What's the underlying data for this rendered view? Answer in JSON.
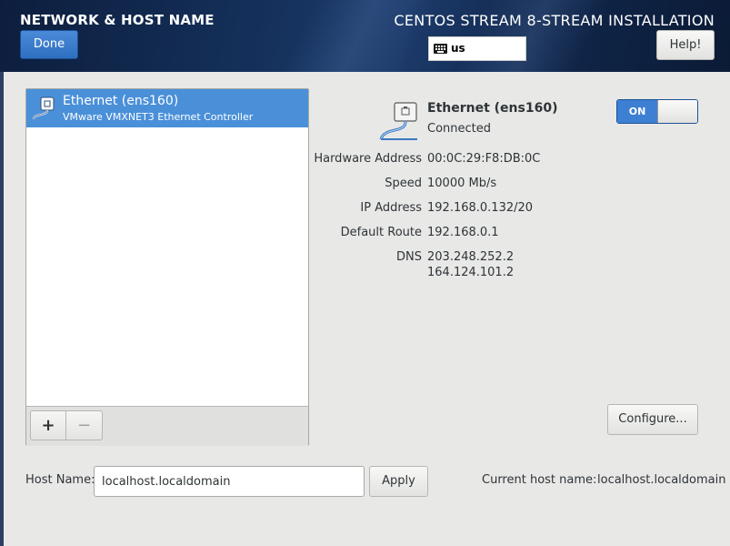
{
  "header": {
    "page_title": "NETWORK & HOST NAME",
    "done_label": "Done",
    "install_title": "CENTOS STREAM 8-STREAM INSTALLATION",
    "keyboard_layout": "us",
    "help_label": "Help!"
  },
  "connections": {
    "items": [
      {
        "name": "Ethernet (ens160)",
        "description": "VMware VMXNET3 Ethernet Controller",
        "selected": true
      }
    ],
    "add_label": "+",
    "remove_label": "−"
  },
  "device": {
    "name": "Ethernet (ens160)",
    "status": "Connected",
    "switch_label": "ON",
    "switch_on": true,
    "properties": [
      {
        "label": "Hardware Address",
        "value": "00:0C:29:F8:DB:0C"
      },
      {
        "label": "Speed",
        "value": "10000 Mb/s"
      },
      {
        "label": "IP Address",
        "value": "192.168.0.132/20"
      },
      {
        "label": "Default Route",
        "value": "192.168.0.1"
      },
      {
        "label": "DNS",
        "value": "203.248.252.2",
        "value2": "164.124.101.2"
      }
    ],
    "configure_label": "Configure..."
  },
  "hostname": {
    "label": "Host Name:",
    "value": "localhost.localdomain",
    "apply_label": "Apply",
    "current_label": "Current host name:",
    "current_value": "localhost.localdomain"
  },
  "colors": {
    "accent": "#4a90d9",
    "header_bg": "#14305a",
    "background": "#e8e8e7"
  }
}
